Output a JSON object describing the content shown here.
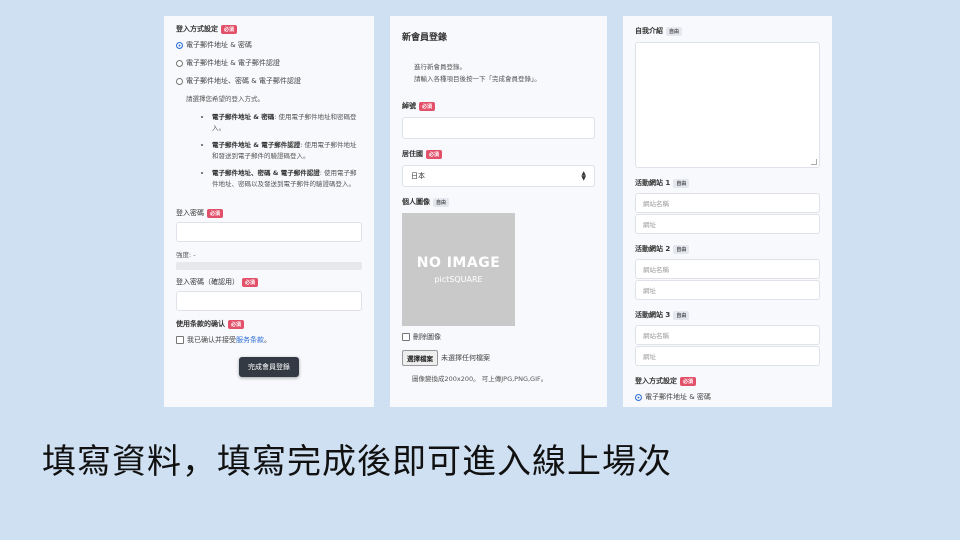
{
  "panel1": {
    "login_method_label": "登入方式設定",
    "required": "必須",
    "options": [
      "電子郵件地址 & 密碼",
      "電子郵件地址 & 電子郵件認證",
      "電子郵件地址、密碼 & 電子郵件認證"
    ],
    "select_prompt": "請選擇您希望的登入方式。",
    "descriptions": [
      {
        "term": "電子郵件地址 & 密碼",
        "text": ": 使用電子郵件地址和密碼登入。"
      },
      {
        "term": "電子郵件地址 & 電子郵件認證",
        "text": ": 使用電子郵件地址和發送到電子郵件的驗證碼登入。"
      },
      {
        "term": "電子郵件地址、密碼 & 電子郵件認證",
        "text": ": 使用電子郵件地址、密碼以及發送到電子郵件的驗證碼登入。"
      }
    ],
    "password_label": "登入密碼",
    "strength_label": "強度: -",
    "password_confirm_label": "登入密碼（確認用）",
    "terms_label": "使用条款的确认",
    "terms_text": "我已确认并接受",
    "terms_link": "服务条款",
    "terms_end": "。",
    "submit_label": "完成會員登錄"
  },
  "panel2": {
    "title": "新會員登錄",
    "intro_line1": "進行新會員登錄。",
    "intro_line2": "請輸入各種項目後按一下「完成會員登錄」。",
    "nickname_label": "綽號",
    "required": "必須",
    "optional": "自由",
    "residence_label": "居住國",
    "residence_value": "日本",
    "image_label": "個人圖像",
    "noimage_big": "NO IMAGE",
    "noimage_sub": "pictSQUARE",
    "delete_image_label": "刪除圖像",
    "file_button": "選擇檔案",
    "file_status": "未選擇任何檔案",
    "image_note": "圖像變換成200x200。 可上傳JPG,PNG,GIF。"
  },
  "panel3": {
    "self_intro_label": "自我介紹",
    "optional": "自由",
    "required": "必須",
    "sites": [
      {
        "label": "活動網站 1",
        "name_placeholder": "網站名稱",
        "url_placeholder": "網址"
      },
      {
        "label": "活動網站 2",
        "name_placeholder": "網站名稱",
        "url_placeholder": "網址"
      },
      {
        "label": "活動網站 3",
        "name_placeholder": "網站名稱",
        "url_placeholder": "網址"
      }
    ],
    "login_method_label": "登入方式設定",
    "first_option": "電子郵件地址 & 密碼"
  },
  "caption": "填寫資料，填寫完成後即可進入線上場次",
  "colors": {
    "background": "#cfe0f2",
    "required_badge": "#e2506a",
    "radio_selected": "#2f6fd6",
    "submit_button": "#333a44"
  },
  "icons": {
    "select_arrow": "chevron-up-down-icon",
    "noimage": "no-image-placeholder"
  }
}
